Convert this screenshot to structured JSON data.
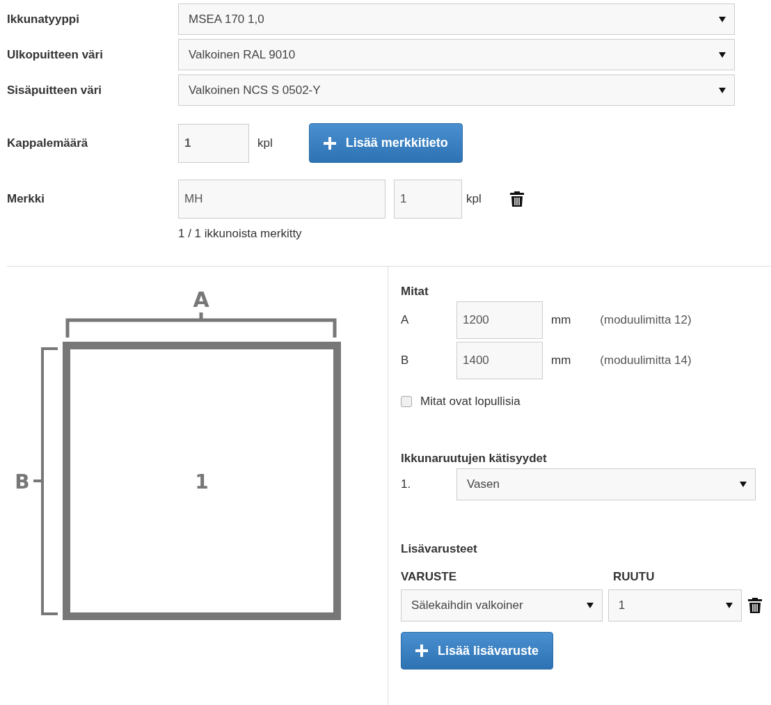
{
  "fields": [
    {
      "label": "Ikkunatyyppi",
      "value": "MSEA 170 1,0"
    },
    {
      "label": "Ulkopuitteen väri",
      "value": "Valkoinen RAL 9010"
    },
    {
      "label": "Sisäpuitteen väri",
      "value": "Valkoinen NCS S 0502-Y"
    }
  ],
  "quantity": {
    "label": "Kappalemäärä",
    "value": "1",
    "unit": "kpl"
  },
  "add_mark_button": "Lisää merkkitieto",
  "mark": {
    "label": "Merkki",
    "value": "MH",
    "count": "1",
    "unit": "kpl"
  },
  "mark_status": "1 / 1 ikkunoista merkitty",
  "drawing": {
    "width_label": "A",
    "height_label": "B",
    "panes": [
      "1"
    ]
  },
  "dimensions": {
    "title": "Mitat",
    "rows": [
      {
        "label": "A",
        "value": "1200",
        "unit": "mm",
        "note": "(moduulimitta 12)"
      },
      {
        "label": "B",
        "value": "1400",
        "unit": "mm",
        "note": "(moduulimitta 14)"
      }
    ],
    "final": {
      "label": "Mitat ovat lopullisia",
      "checked": false
    }
  },
  "handedness": {
    "title": "Ikkunaruutujen kätisyydet",
    "rows": [
      {
        "label": "1.",
        "value": "Vasen"
      }
    ]
  },
  "accessories": {
    "title": "Lisävarusteet",
    "columns": [
      "VARUSTE",
      "RUUTU"
    ],
    "rows": [
      {
        "accessory": "Sälekaihdin valkoiner",
        "pane": "1"
      }
    ],
    "add_button": "Lisää lisävaruste"
  }
}
